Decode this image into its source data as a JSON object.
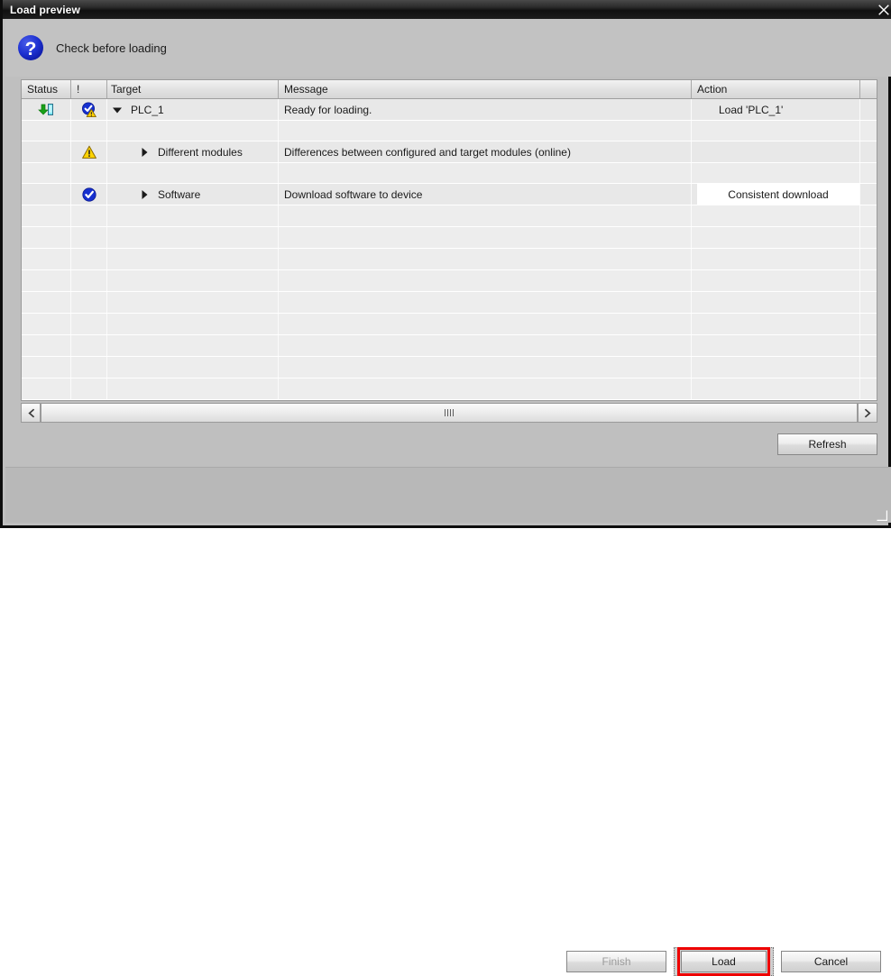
{
  "window": {
    "title": "Load preview",
    "close_icon": "close-x-icon"
  },
  "header": {
    "icon": "question-mark-icon",
    "caption": "Check before loading"
  },
  "table": {
    "columns": [
      {
        "key": "status",
        "label": "Status"
      },
      {
        "key": "warning",
        "label": "!"
      },
      {
        "key": "target",
        "label": "Target"
      },
      {
        "key": "message",
        "label": "Message"
      },
      {
        "key": "action",
        "label": "Action"
      },
      {
        "key": "end",
        "label": ""
      }
    ],
    "rows": [
      {
        "status_icon": "download-to-device-icon",
        "severity_icon": "info-check-warning-icon",
        "expander": "triangle-down-icon",
        "indent": false,
        "target": "PLC_1",
        "message": "Ready for loading.",
        "action": "Load 'PLC_1'",
        "action_style": "plain"
      },
      {
        "status_icon": "",
        "severity_icon": "warning-triangle-icon",
        "expander": "triangle-right-icon",
        "indent": true,
        "target": "Different modules",
        "message": "Differences between configured and target modules (online)",
        "action": "",
        "action_style": "none"
      },
      {
        "status_icon": "",
        "severity_icon": "check-circle-icon",
        "expander": "triangle-right-icon",
        "indent": true,
        "target": "Software",
        "message": "Download software to device",
        "action": "Consistent download",
        "action_style": "dropdown"
      }
    ],
    "empty_row_count": 9
  },
  "scrollbar": {
    "left_arrow_icon": "chevron-left-icon",
    "right_arrow_icon": "chevron-right-icon",
    "grip_icon": "grip-lines-icon"
  },
  "buttons": {
    "refresh": "Refresh",
    "finish": "Finish",
    "load": "Load",
    "cancel": "Cancel"
  },
  "colors": {
    "highlight": "#ee0000",
    "accent_blue": "#1630d0",
    "warning_yellow": "#ffd000",
    "download_green": "#19a019",
    "panel": "#c2c2c2"
  }
}
